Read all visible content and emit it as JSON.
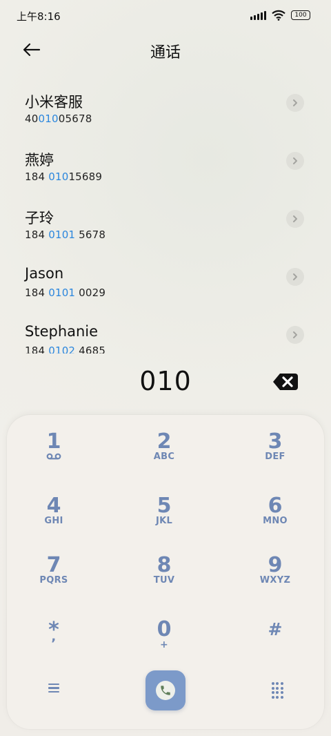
{
  "status_bar": {
    "time": "上午8:16",
    "battery": "100",
    "icons": [
      "signal-icon",
      "wifi-icon",
      "battery-icon"
    ]
  },
  "header": {
    "title": "通话",
    "back_icon": "arrow-left-icon"
  },
  "contacts": [
    {
      "name": "小米客服",
      "number_pre": "40",
      "number_match": "010",
      "number_post": "05678"
    },
    {
      "name": "燕婷",
      "number_pre": "184 ",
      "number_match": "010",
      "number_post": "15689"
    },
    {
      "name": "子玲",
      "number_pre": "184 ",
      "number_match": "0101",
      "number_post": " 5678"
    },
    {
      "name": "Jason",
      "number_pre": "184 ",
      "number_match": "0101",
      "number_post": " 0029"
    },
    {
      "name": "Stephanie",
      "number_pre": "184 ",
      "number_match": "0102",
      "number_post": " 4685"
    }
  ],
  "dialer": {
    "input": "010",
    "delete_icon": "backspace-icon"
  },
  "keypad": {
    "keys": [
      {
        "digit": "1",
        "letters": "",
        "icon": "voicemail-icon"
      },
      {
        "digit": "2",
        "letters": "ABC"
      },
      {
        "digit": "3",
        "letters": "DEF"
      },
      {
        "digit": "4",
        "letters": "GHI"
      },
      {
        "digit": "5",
        "letters": "JKL"
      },
      {
        "digit": "6",
        "letters": "MNO"
      },
      {
        "digit": "7",
        "letters": "PQRS"
      },
      {
        "digit": "8",
        "letters": "TUV"
      },
      {
        "digit": "9",
        "letters": "WXYZ"
      },
      {
        "digit": "*",
        "letters": ","
      },
      {
        "digit": "0",
        "letters": "+"
      },
      {
        "digit": "#",
        "letters": ""
      }
    ]
  },
  "bottom": {
    "menu_icon": "menu-icon",
    "call_icon": "phone-icon",
    "keypad_icon": "dialpad-icon"
  },
  "colors": {
    "accent": "#6e87b4",
    "highlight": "#2b86dd",
    "call_button": "#7c9ac9"
  }
}
